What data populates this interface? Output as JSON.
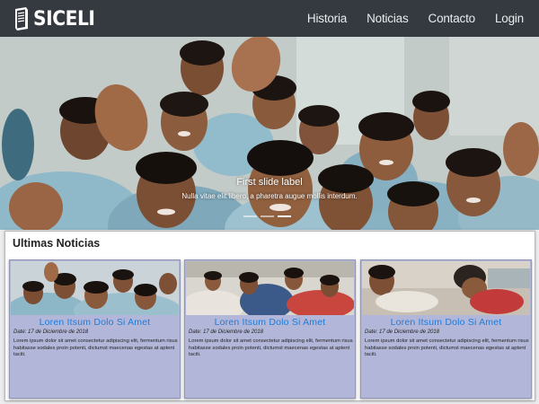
{
  "brand": {
    "name": "SICELI",
    "logo_icon": "book-icon"
  },
  "nav": {
    "items": [
      {
        "label": "Historia"
      },
      {
        "label": "Noticias"
      },
      {
        "label": "Contacto"
      },
      {
        "label": "Login"
      }
    ]
  },
  "carousel": {
    "caption_title": "First slide label",
    "caption_text": "Nulla vitae elit libero, a pharetra augue mollis interdum.",
    "slide_count": 3,
    "active_slide": 2
  },
  "news": {
    "title": "Ultimas Noticias",
    "cards": [
      {
        "title": "Loren Itsum Dolo Si Amet",
        "date": "Date: 17 de Diciembre de 2018",
        "text": "Lorem ipsum dolor sit amet consectetur adipiscing elit, fermentum risus habitasse sodales proin potenti, dictumst maecenas egestas at aptent taciti."
      },
      {
        "title": "Loren Itsum Dolo Si Amet",
        "date": "Date: 17 de Diciembre de 2018",
        "text": "Lorem ipsum dolor sit amet consectetur adipiscing elit, fermentum risus habitasse sodales proin potenti, dictumst maecenas egestas at aptent taciti."
      },
      {
        "title": "Loren Itsum Dolo Si Amet",
        "date": "Date: 17 de Diciembre de 2018",
        "text": "Lorem ipsum dolor sit amet consectetur adipiscing elit, fermentum risus habitasse sodales proin potenti, dictumst maecenas egestas at aptent taciti."
      }
    ]
  },
  "colors": {
    "navbar_bg": "#343a40",
    "card_bg": "#b2b7d9",
    "card_title": "#1e7bd8"
  }
}
